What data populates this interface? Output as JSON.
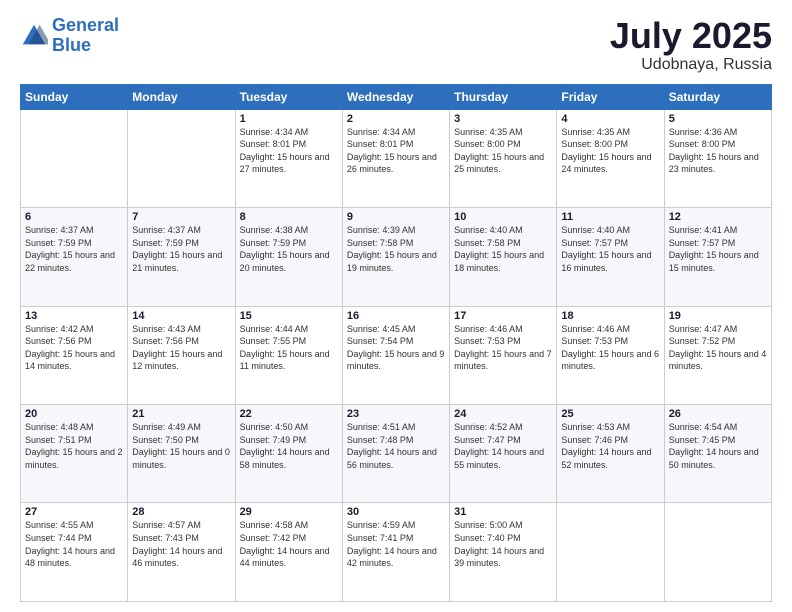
{
  "logo": {
    "line1": "General",
    "line2": "Blue"
  },
  "title": "July 2025",
  "subtitle": "Udobnaya, Russia",
  "header_days": [
    "Sunday",
    "Monday",
    "Tuesday",
    "Wednesday",
    "Thursday",
    "Friday",
    "Saturday"
  ],
  "weeks": [
    [
      {
        "day": "",
        "sunrise": "",
        "sunset": "",
        "daylight": ""
      },
      {
        "day": "",
        "sunrise": "",
        "sunset": "",
        "daylight": ""
      },
      {
        "day": "1",
        "sunrise": "Sunrise: 4:34 AM",
        "sunset": "Sunset: 8:01 PM",
        "daylight": "Daylight: 15 hours and 27 minutes."
      },
      {
        "day": "2",
        "sunrise": "Sunrise: 4:34 AM",
        "sunset": "Sunset: 8:01 PM",
        "daylight": "Daylight: 15 hours and 26 minutes."
      },
      {
        "day": "3",
        "sunrise": "Sunrise: 4:35 AM",
        "sunset": "Sunset: 8:00 PM",
        "daylight": "Daylight: 15 hours and 25 minutes."
      },
      {
        "day": "4",
        "sunrise": "Sunrise: 4:35 AM",
        "sunset": "Sunset: 8:00 PM",
        "daylight": "Daylight: 15 hours and 24 minutes."
      },
      {
        "day": "5",
        "sunrise": "Sunrise: 4:36 AM",
        "sunset": "Sunset: 8:00 PM",
        "daylight": "Daylight: 15 hours and 23 minutes."
      }
    ],
    [
      {
        "day": "6",
        "sunrise": "Sunrise: 4:37 AM",
        "sunset": "Sunset: 7:59 PM",
        "daylight": "Daylight: 15 hours and 22 minutes."
      },
      {
        "day": "7",
        "sunrise": "Sunrise: 4:37 AM",
        "sunset": "Sunset: 7:59 PM",
        "daylight": "Daylight: 15 hours and 21 minutes."
      },
      {
        "day": "8",
        "sunrise": "Sunrise: 4:38 AM",
        "sunset": "Sunset: 7:59 PM",
        "daylight": "Daylight: 15 hours and 20 minutes."
      },
      {
        "day": "9",
        "sunrise": "Sunrise: 4:39 AM",
        "sunset": "Sunset: 7:58 PM",
        "daylight": "Daylight: 15 hours and 19 minutes."
      },
      {
        "day": "10",
        "sunrise": "Sunrise: 4:40 AM",
        "sunset": "Sunset: 7:58 PM",
        "daylight": "Daylight: 15 hours and 18 minutes."
      },
      {
        "day": "11",
        "sunrise": "Sunrise: 4:40 AM",
        "sunset": "Sunset: 7:57 PM",
        "daylight": "Daylight: 15 hours and 16 minutes."
      },
      {
        "day": "12",
        "sunrise": "Sunrise: 4:41 AM",
        "sunset": "Sunset: 7:57 PM",
        "daylight": "Daylight: 15 hours and 15 minutes."
      }
    ],
    [
      {
        "day": "13",
        "sunrise": "Sunrise: 4:42 AM",
        "sunset": "Sunset: 7:56 PM",
        "daylight": "Daylight: 15 hours and 14 minutes."
      },
      {
        "day": "14",
        "sunrise": "Sunrise: 4:43 AM",
        "sunset": "Sunset: 7:56 PM",
        "daylight": "Daylight: 15 hours and 12 minutes."
      },
      {
        "day": "15",
        "sunrise": "Sunrise: 4:44 AM",
        "sunset": "Sunset: 7:55 PM",
        "daylight": "Daylight: 15 hours and 11 minutes."
      },
      {
        "day": "16",
        "sunrise": "Sunrise: 4:45 AM",
        "sunset": "Sunset: 7:54 PM",
        "daylight": "Daylight: 15 hours and 9 minutes."
      },
      {
        "day": "17",
        "sunrise": "Sunrise: 4:46 AM",
        "sunset": "Sunset: 7:53 PM",
        "daylight": "Daylight: 15 hours and 7 minutes."
      },
      {
        "day": "18",
        "sunrise": "Sunrise: 4:46 AM",
        "sunset": "Sunset: 7:53 PM",
        "daylight": "Daylight: 15 hours and 6 minutes."
      },
      {
        "day": "19",
        "sunrise": "Sunrise: 4:47 AM",
        "sunset": "Sunset: 7:52 PM",
        "daylight": "Daylight: 15 hours and 4 minutes."
      }
    ],
    [
      {
        "day": "20",
        "sunrise": "Sunrise: 4:48 AM",
        "sunset": "Sunset: 7:51 PM",
        "daylight": "Daylight: 15 hours and 2 minutes."
      },
      {
        "day": "21",
        "sunrise": "Sunrise: 4:49 AM",
        "sunset": "Sunset: 7:50 PM",
        "daylight": "Daylight: 15 hours and 0 minutes."
      },
      {
        "day": "22",
        "sunrise": "Sunrise: 4:50 AM",
        "sunset": "Sunset: 7:49 PM",
        "daylight": "Daylight: 14 hours and 58 minutes."
      },
      {
        "day": "23",
        "sunrise": "Sunrise: 4:51 AM",
        "sunset": "Sunset: 7:48 PM",
        "daylight": "Daylight: 14 hours and 56 minutes."
      },
      {
        "day": "24",
        "sunrise": "Sunrise: 4:52 AM",
        "sunset": "Sunset: 7:47 PM",
        "daylight": "Daylight: 14 hours and 55 minutes."
      },
      {
        "day": "25",
        "sunrise": "Sunrise: 4:53 AM",
        "sunset": "Sunset: 7:46 PM",
        "daylight": "Daylight: 14 hours and 52 minutes."
      },
      {
        "day": "26",
        "sunrise": "Sunrise: 4:54 AM",
        "sunset": "Sunset: 7:45 PM",
        "daylight": "Daylight: 14 hours and 50 minutes."
      }
    ],
    [
      {
        "day": "27",
        "sunrise": "Sunrise: 4:55 AM",
        "sunset": "Sunset: 7:44 PM",
        "daylight": "Daylight: 14 hours and 48 minutes."
      },
      {
        "day": "28",
        "sunrise": "Sunrise: 4:57 AM",
        "sunset": "Sunset: 7:43 PM",
        "daylight": "Daylight: 14 hours and 46 minutes."
      },
      {
        "day": "29",
        "sunrise": "Sunrise: 4:58 AM",
        "sunset": "Sunset: 7:42 PM",
        "daylight": "Daylight: 14 hours and 44 minutes."
      },
      {
        "day": "30",
        "sunrise": "Sunrise: 4:59 AM",
        "sunset": "Sunset: 7:41 PM",
        "daylight": "Daylight: 14 hours and 42 minutes."
      },
      {
        "day": "31",
        "sunrise": "Sunrise: 5:00 AM",
        "sunset": "Sunset: 7:40 PM",
        "daylight": "Daylight: 14 hours and 39 minutes."
      },
      {
        "day": "",
        "sunrise": "",
        "sunset": "",
        "daylight": ""
      },
      {
        "day": "",
        "sunrise": "",
        "sunset": "",
        "daylight": ""
      }
    ]
  ]
}
